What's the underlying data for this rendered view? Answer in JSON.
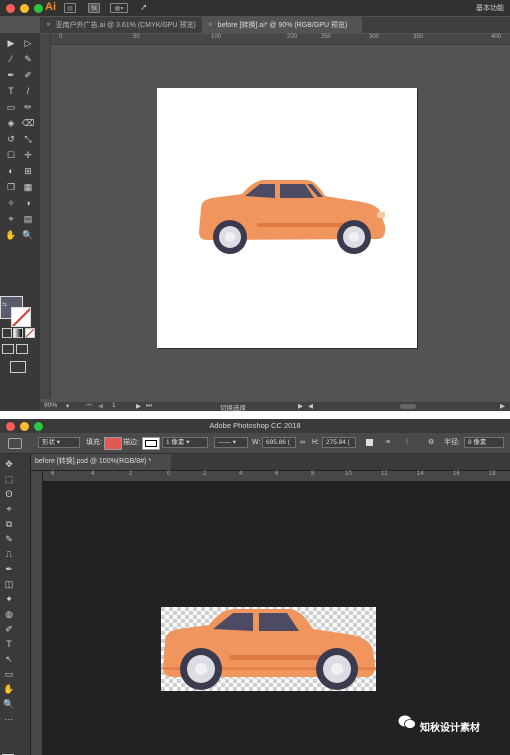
{
  "illustrator": {
    "app_label": "Ai",
    "workspace_label": "基本功能",
    "tabs": [
      {
        "label": "亚南户外广告.ai @ 3.61% (CMYK/GPU 预览)",
        "active": false
      },
      {
        "label": "before [转换].ai* @ 90% (RGB/GPU 预览)",
        "active": true
      }
    ],
    "ruler_ticks": [
      "0",
      "50",
      "100",
      "200",
      "250",
      "300",
      "350",
      "400"
    ],
    "tools": [
      "▶",
      "▷",
      "⁄",
      "✎",
      "✒",
      "✐",
      "T",
      "/",
      "▭",
      "✏",
      "◈",
      "⌫",
      "↺",
      "⤡",
      "☐",
      "✛",
      "◐",
      "⊞",
      "❐",
      "▦",
      "✧",
      "◑",
      "⌖",
      "▤",
      "✋",
      "🔍"
    ],
    "status": {
      "zoom": "90%",
      "page": "1",
      "tool_label": "切换选择"
    },
    "colors": {
      "fill": "#5b5b6e",
      "stroke_slash": "#d23a2f",
      "car_body": "#f0955d",
      "car_body_dark": "#e07a45",
      "car_window": "#4c4b63",
      "wheel": "#3b3a4f",
      "hub": "#dcdde3"
    }
  },
  "photoshop": {
    "title": "Adobe Photoshop CC 2018",
    "options": {
      "shape_mode": "形状",
      "fill_label": "填充:",
      "stroke_label": "描边:",
      "stroke_width": "1 像素",
      "w_label": "W:",
      "w_value": "695.86 (",
      "h_label": "H:",
      "h_value": "275.84 (",
      "radius_label": "半径:",
      "radius_value": "8 像素",
      "fill_color": "#e05a55"
    },
    "doc_tab": "before [转换].psd @ 100%(RGB/8#) *",
    "ruler_ticks": [
      "6",
      "4",
      "2",
      "0",
      "2",
      "4",
      "6",
      "8",
      "10",
      "12",
      "14",
      "16",
      "18"
    ],
    "tools": [
      "✥",
      "⬚",
      "ʘ",
      "⌖",
      "⧉",
      "✎",
      "⎍",
      "✒",
      "◫",
      "✦",
      "◍",
      "✐",
      "T",
      "↖",
      "▭",
      "✋",
      "🔍",
      "···"
    ],
    "watermark": "知秋设计素材"
  }
}
